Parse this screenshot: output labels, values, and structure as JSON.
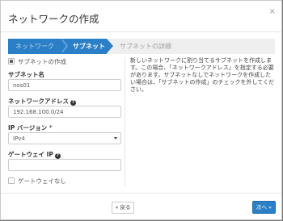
{
  "dialog": {
    "title": "ネットワークの作成",
    "close_glyph": "×"
  },
  "wizard": {
    "steps": [
      {
        "label": "ネットワーク",
        "state": "completed"
      },
      {
        "label": "サブネット",
        "state": "active"
      },
      {
        "label": "サブネットの詳細",
        "state": "pending"
      }
    ],
    "active_color": "#2a7fc6"
  },
  "form": {
    "create_subnet": {
      "label": "サブネットの作成",
      "checked": true
    },
    "subnet_name": {
      "label": "サブネット名",
      "value": "nos01"
    },
    "network_address": {
      "label": "ネットワークアドレス",
      "value": "192.168.100.0/24",
      "help_icon": "question-circle-icon"
    },
    "ip_version": {
      "label": "IP バージョン",
      "required_mark": "*",
      "value": "IPv4"
    },
    "gateway_ip": {
      "label": "ゲートウェイ IP",
      "value": "",
      "help_icon": "question-circle-icon"
    },
    "no_gateway": {
      "label": "ゲートウェイなし",
      "checked": false
    }
  },
  "help_text": "新しいネットワークに割り当てるサブネットを作成します。この場合、「ネットワークアドレス」を指定する必要があります。サブネットなしでネットワークを作成したい場合は、「サブネットの作成」のチェックを外してください。",
  "footer": {
    "back_label": "« 戻る",
    "next_label": "次へ »"
  }
}
